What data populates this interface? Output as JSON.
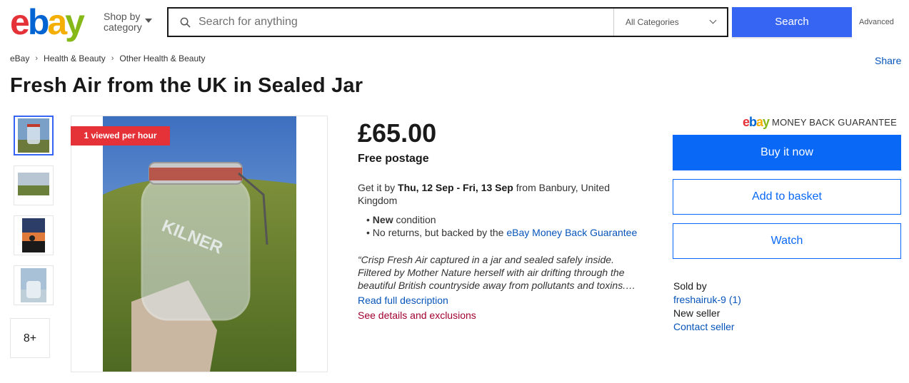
{
  "header": {
    "logo": {
      "e": "e",
      "b": "b",
      "a": "a",
      "y": "y"
    },
    "shop_by": "Shop by category",
    "search_placeholder": "Search for anything",
    "category_selected": "All Categories",
    "search_button": "Search",
    "advanced": "Advanced"
  },
  "breadcrumb": [
    "eBay",
    "Health & Beauty",
    "Other Health & Beauty"
  ],
  "share": "Share",
  "title": "Fresh Air from the UK in Sealed Jar",
  "gallery": {
    "badge": "1 viewed per hour",
    "more": "8+"
  },
  "listing": {
    "price": "£65.00",
    "postage": "Free postage",
    "delivery_prefix": "Get it by",
    "delivery_dates": "Thu, 12 Sep - Fri, 13 Sep",
    "delivery_suffix": "from Banbury, United Kingdom",
    "condition_bold": "New",
    "condition_text": "condition",
    "returns_text": "No returns, but backed by the",
    "returns_link": "eBay Money Back Guarantee",
    "description": "“Crisp Fresh Air captured in a jar and sealed safely inside. Filtered by Mother Nature herself with air drifting through the beautiful British countryside away from pollutants and toxins.…",
    "read_more": "Read full description",
    "see_details": "See details and exclusions"
  },
  "actions": {
    "mbg_text": "MONEY BACK GUARANTEE",
    "buy_now": "Buy it now",
    "add_to_basket": "Add to basket",
    "watch": "Watch"
  },
  "seller": {
    "label": "Sold by",
    "name": "freshairuk-9",
    "feedback": "(1)",
    "status": "New seller",
    "contact": "Contact seller"
  },
  "colors": {
    "primary_blue": "#3665f3",
    "buy_blue": "#0968f6",
    "badge_red": "#e53238",
    "details_red": "#a2002e"
  }
}
